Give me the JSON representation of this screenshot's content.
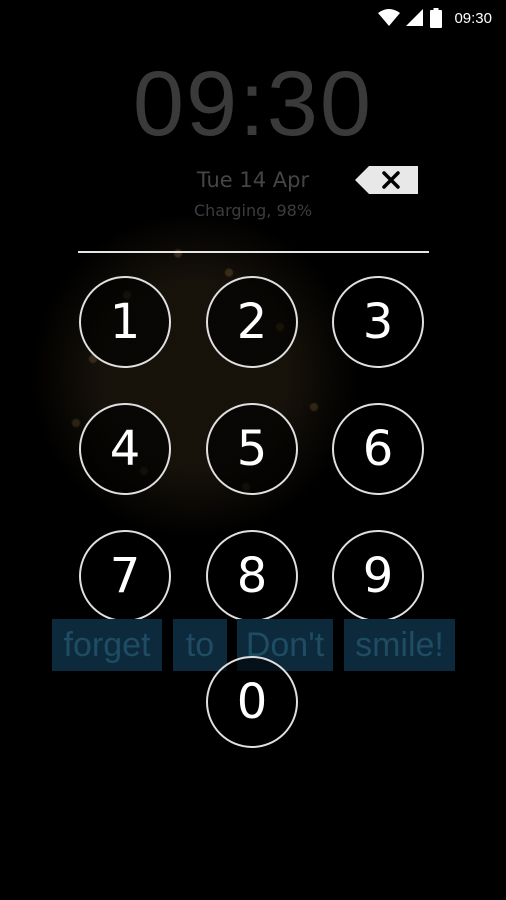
{
  "status_bar": {
    "time": "09:30",
    "icons": [
      "wifi-icon",
      "cell-signal-icon",
      "battery-icon"
    ]
  },
  "lock_screen": {
    "clock": "09:30",
    "date": "Tue 14 Apr",
    "charging": "Charging, 98%",
    "backspace_icon": "backspace-icon"
  },
  "keypad": {
    "keys": [
      "1",
      "2",
      "3",
      "4",
      "5",
      "6",
      "7",
      "8",
      "9",
      "0"
    ]
  },
  "message_words": [
    "forget",
    "to",
    "Don't",
    "smile!"
  ],
  "colors": {
    "background": "#000000",
    "key_border": "#e0e0e0",
    "message_bg": "#0d2a3c",
    "message_text": "#1d4c63"
  }
}
